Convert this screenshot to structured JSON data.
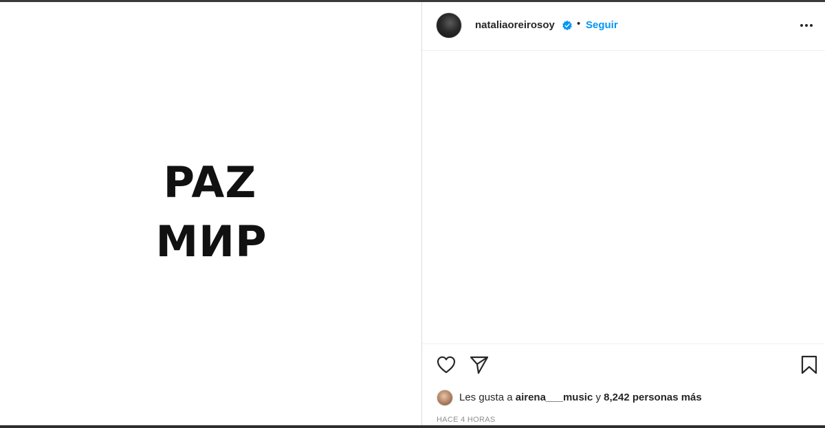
{
  "media": {
    "line1": "PAZ",
    "line2": "МИР"
  },
  "post": {
    "username": "nataliaoreirosoy",
    "verified_icon": "verified-badge-icon",
    "separator": "•",
    "follow_label": "Seguir",
    "more_icon": "more-options-icon"
  },
  "actions": {
    "like_icon": "heart-icon",
    "share_icon": "paper-plane-icon",
    "save_icon": "bookmark-icon"
  },
  "likes": {
    "prefix": "Les gusta a",
    "user": "airena___music",
    "middle": "y",
    "count": "8,242 personas más"
  },
  "timestamp": "HACE 4 HORAS",
  "colors": {
    "link_blue": "#0095f6",
    "text": "#262626",
    "muted": "#8e8e8e",
    "border": "#dbdbdb"
  }
}
